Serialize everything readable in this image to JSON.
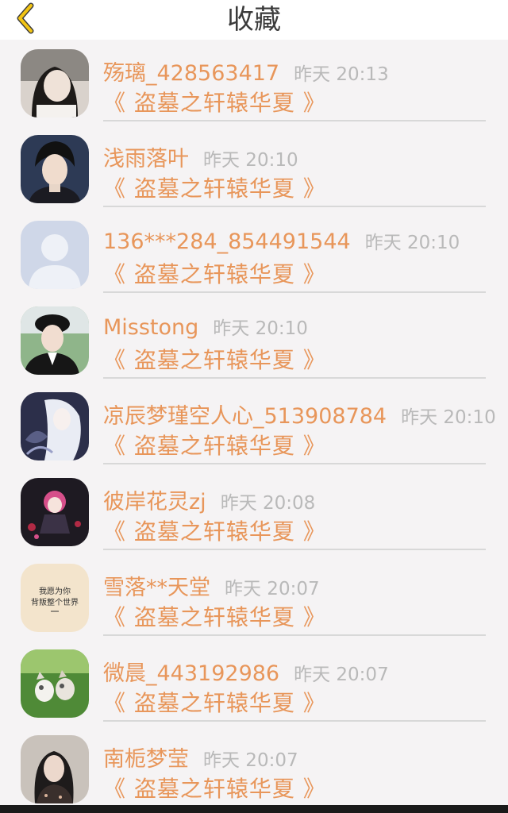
{
  "header": {
    "title": "收藏",
    "back_icon": "chevron-left-icon",
    "accent": "#f2c414"
  },
  "colors": {
    "name": "#e8965a",
    "time": "#b9b9b9",
    "divider": "#d8d8d8"
  },
  "favorites": [
    {
      "user": "殇璃_428563417",
      "time": "昨天 20:13",
      "book": "《 盗墓之轩辕华夏 》"
    },
    {
      "user": "浅雨落叶",
      "time": "昨天 20:10",
      "book": "《 盗墓之轩辕华夏 》"
    },
    {
      "user": "136***284_854491544",
      "time": "昨天 20:10",
      "book": "《 盗墓之轩辕华夏 》"
    },
    {
      "user": "Misstong",
      "time": "昨天 20:10",
      "book": "《 盗墓之轩辕华夏 》"
    },
    {
      "user": "凉辰梦瑾空人心_513908784",
      "time": "昨天 20:10",
      "book": "《 盗墓之轩辕华夏 》"
    },
    {
      "user": "彼岸花灵zj",
      "time": "昨天 20:08",
      "book": "《 盗墓之轩辕华夏 》"
    },
    {
      "user": "雪落**天堂",
      "time": "昨天 20:07",
      "book": "《 盗墓之轩辕华夏 》"
    },
    {
      "user": "微晨_443192986",
      "time": "昨天 20:07",
      "book": "《 盗墓之轩辕华夏 》"
    },
    {
      "user": "南栀梦莹",
      "time": "昨天 20:07",
      "book": "《 盗墓之轩辕华夏 》"
    }
  ],
  "avatar_text": {
    "line1": "我愿为你",
    "line2": "背叛整个世界"
  }
}
